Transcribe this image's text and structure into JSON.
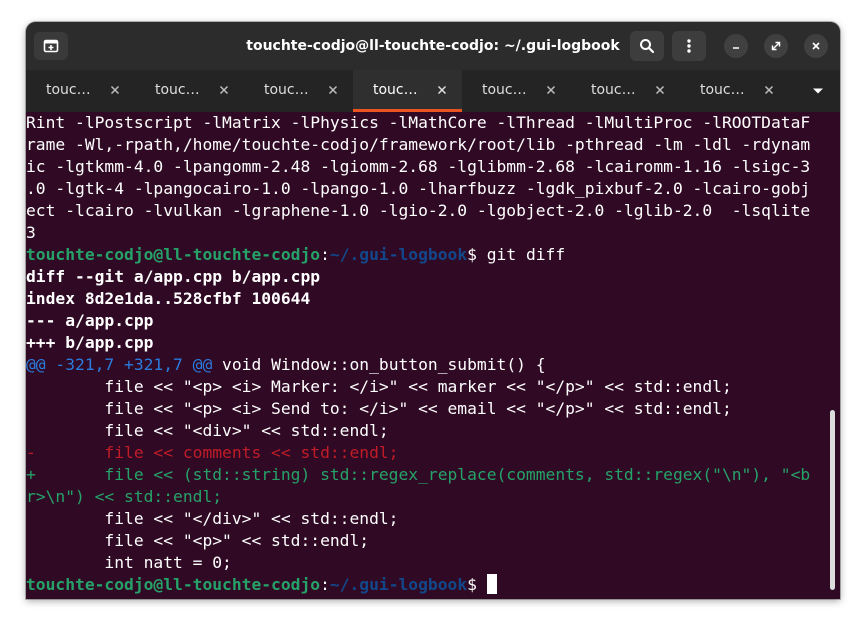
{
  "window": {
    "title": "touchte-codjo@ll-touchte-codjo: ~/.gui-logbook",
    "icons": {
      "new_tab": "new-tab-icon",
      "search": "search-icon",
      "menu": "kebab-menu-icon",
      "minimize": "minimize-icon",
      "maximize": "restore-icon",
      "close": "close-icon"
    }
  },
  "tabs": [
    {
      "label": "touc…",
      "active": false
    },
    {
      "label": "touc…",
      "active": false
    },
    {
      "label": "touc…",
      "active": false
    },
    {
      "label": "touc…",
      "active": true
    },
    {
      "label": "touc…",
      "active": false
    },
    {
      "label": "touc…",
      "active": false
    },
    {
      "label": "touc…",
      "active": false
    }
  ],
  "colors": {
    "terminal_bg": "#300a24",
    "prompt_user": "#26a269",
    "prompt_path": "#12488b",
    "hunk": "#2a7bde",
    "removed": "#c01c28",
    "added": "#26a269",
    "active_tab_indicator": "#e95420"
  },
  "terminal": {
    "prompt_user": "touchte-codjo@ll-touchte-codjo",
    "prompt_sep": ":",
    "prompt_path": "~/.gui-logbook",
    "prompt_end": "$ ",
    "command": "git diff",
    "output_top": [
      "Rint -lPostscript -lMatrix -lPhysics -lMathCore -lThread -lMultiProc -lROOTDataF",
      "rame -Wl,-rpath,/home/touchte-codjo/framework/root/lib -pthread -lm -ldl -rdynam",
      "ic -lgtkmm-4.0 -lpangomm-2.48 -lgiomm-2.68 -lglibmm-2.68 -lcairomm-1.16 -lsigc-3",
      ".0 -lgtk-4 -lpangocairo-1.0 -lpango-1.0 -lharfbuzz -lgdk_pixbuf-2.0 -lcairo-gobj",
      "ect -lcairo -lvulkan -lgraphene-1.0 -lgio-2.0 -lgobject-2.0 -lglib-2.0  -lsqlite",
      "3"
    ],
    "diff_header": [
      "diff --git a/app.cpp b/app.cpp",
      "index 8d2e1da..528cfbf 100644",
      "--- a/app.cpp",
      "+++ b/app.cpp"
    ],
    "hunk_header": "@@ -321,7 +321,7 @@",
    "hunk_context": " void Window::on_button_submit() {",
    "context_before": [
      "        file << \"<p> <i> Marker: </i>\" << marker << \"</p>\" << std::endl;",
      "        file << \"<p> <i> Send to: </i>\" << email << \"</p>\" << std::endl;",
      "        file << \"<div>\" << std::endl;"
    ],
    "removed_line": "-       file << comments << std::endl;",
    "added_lines": [
      "+       file << (std::string) std::regex_replace(comments, std::regex(\"\\n\"), \"<b",
      "r>\\n\") << std::endl;"
    ],
    "context_after": [
      "        file << \"</div>\" << std::endl;",
      "        file << \"<p>\" << std::endl;",
      "        int natt = 0;"
    ]
  }
}
